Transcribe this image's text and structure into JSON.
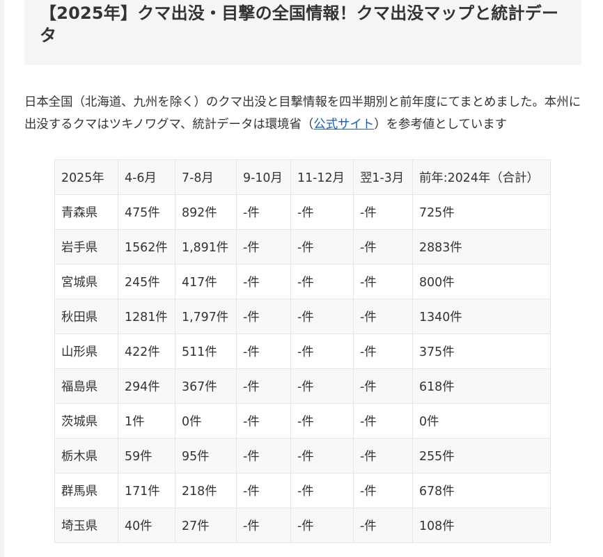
{
  "article": {
    "heading": "【2025年】クマ出没・目撃の全国情報！クマ出没マップと統計データ",
    "intro_before_link": "日本全国（北海道、九州を除く）のクマ出没と目撃情報を四半期別と前年度にてまとめました。本州に出没するクマはツキノワグマ、統計データは環境省（",
    "intro_link": "公式サイト",
    "intro_after_link": "）を参考値としています"
  },
  "table": {
    "headers": [
      "2025年",
      "4-6月",
      "7-8月",
      "9-10月",
      "11-12月",
      "翌1-3月",
      "前年:2024年（合計）"
    ],
    "rows": [
      [
        "青森県",
        "475件",
        "892件",
        "-件",
        "-件",
        "-件",
        "725件"
      ],
      [
        "岩手県",
        "1562件",
        "1,891件",
        "-件",
        "-件",
        "-件",
        "2883件"
      ],
      [
        "宮城県",
        "245件",
        "417件",
        "-件",
        "-件",
        "-件",
        "800件"
      ],
      [
        "秋田県",
        "1281件",
        "1,797件",
        "-件",
        "-件",
        "-件",
        "1340件"
      ],
      [
        "山形県",
        "422件",
        "511件",
        "-件",
        "-件",
        "-件",
        "375件"
      ],
      [
        "福島県",
        "294件",
        "367件",
        "-件",
        "-件",
        "-件",
        "618件"
      ],
      [
        "茨城県",
        "1件",
        "0件",
        "-件",
        "-件",
        "-件",
        "0件"
      ],
      [
        "栃木県",
        "59件",
        "95件",
        "-件",
        "-件",
        "-件",
        "255件"
      ],
      [
        "群馬県",
        "171件",
        "218件",
        "-件",
        "-件",
        "-件",
        "678件"
      ],
      [
        "埼玉県",
        "40件",
        "27件",
        "-件",
        "-件",
        "-件",
        "108件"
      ]
    ]
  },
  "colors": {
    "heading_background": "#f4f5f7",
    "link": "#1a5fb4",
    "row_stripe": "#f7f8fa",
    "border": "#e6e6e6"
  }
}
